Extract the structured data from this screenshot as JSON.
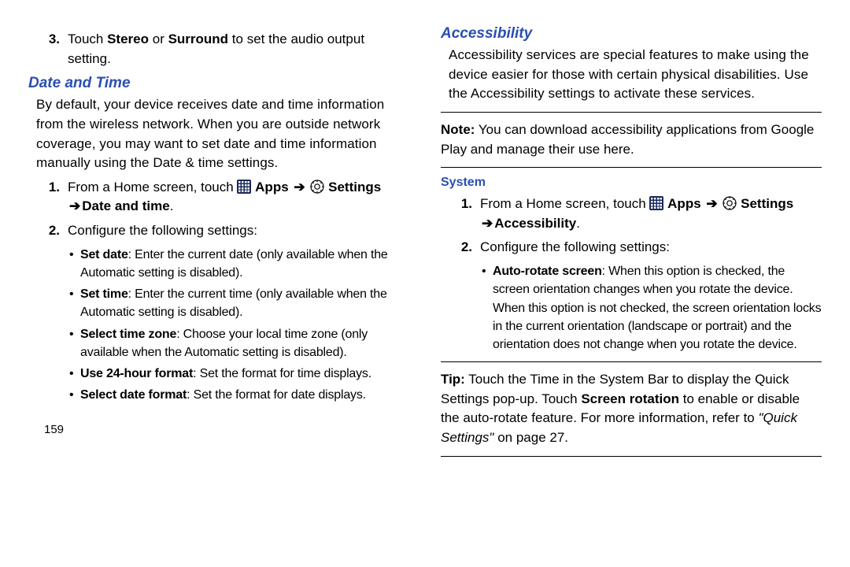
{
  "left": {
    "step3": {
      "num": "3.",
      "pre": "Touch ",
      "s1": "Stereo",
      "mid": " or ",
      "s2": "Surround",
      "post": " to set the audio output setting."
    },
    "heading": "Date and Time",
    "intro": "By default, your device receives date and time information from the wireless network. When you are outside network coverage, you may want to set date and time information manually using the Date & time settings.",
    "step1": {
      "num": "1.",
      "pre": "From a Home screen, touch ",
      "apps": " Apps ",
      "settings": " Settings",
      "arrow2": "➔ ",
      "target": "Date and time",
      "dot": "."
    },
    "step2": {
      "num": "2.",
      "text": "Configure the following settings:"
    },
    "bullets": [
      {
        "title": "Set date",
        "rest": ": Enter the current date (only available when the Automatic setting is disabled)."
      },
      {
        "title": "Set time",
        "rest": ": Enter the current time (only available when the Automatic setting is disabled)."
      },
      {
        "title": "Select time zone",
        "rest": ": Choose your local time zone (only available when the Automatic setting is disabled)."
      },
      {
        "title": "Use 24-hour format",
        "rest": ": Set the format for time displays."
      },
      {
        "title": "Select date format",
        "rest": ": Set the format for date displays."
      }
    ],
    "page_number": "159"
  },
  "right": {
    "heading": "Accessibility",
    "intro": "Accessibility services are special features to make using the device easier for those with certain physical disabilities. Use the Accessibility settings to activate these services.",
    "note": {
      "label": "Note:",
      "text": " You can download accessibility applications from Google Play and manage their use here."
    },
    "sub": "System",
    "step1": {
      "num": "1.",
      "pre": "From a Home screen, touch ",
      "apps": " Apps ",
      "settings": " Settings",
      "arrow2": "➔ ",
      "target": "Accessibility",
      "dot": "."
    },
    "step2": {
      "num": "2.",
      "text": "Configure the following settings:"
    },
    "bullets": [
      {
        "title": "Auto-rotate screen",
        "rest": ": When this option is checked, the screen orientation changes when you rotate the device. When this option is not checked, the screen orientation locks in the current orientation (landscape or portrait) and the orientation does not change when you rotate the device."
      }
    ],
    "tip": {
      "label": "Tip:",
      "pre": " Touch the Time in the System Bar to display the Quick Settings pop-up. Touch ",
      "bold1": "Screen rotation",
      "mid": " to enable or disable the auto-rotate feature. For more information, refer to ",
      "ital": "\"Quick Settings\"",
      "post": " on page 27."
    }
  },
  "arrow": "➔"
}
